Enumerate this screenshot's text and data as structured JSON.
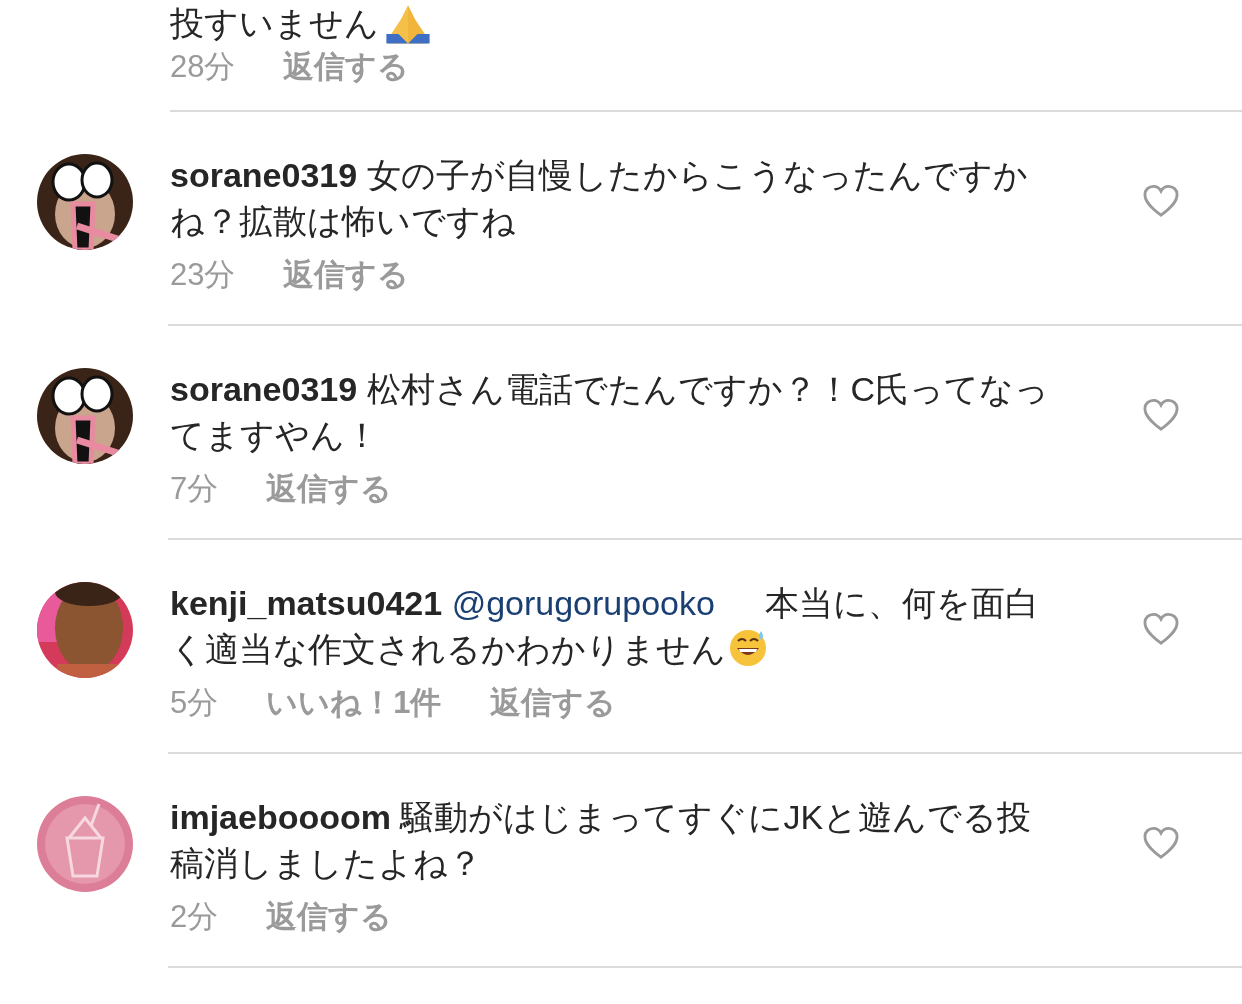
{
  "top_comment": {
    "kind": "pray",
    "text": "投すいません",
    "time": "28分",
    "reply": "返信する"
  },
  "comments": [
    {
      "kind": "plain",
      "user": "sorane0319",
      "text": "女の子が自慢したからこうなったんですかね？拡散は怖いですね",
      "time": "23分",
      "reply": "返信する",
      "liked": false
    },
    {
      "kind": "plain",
      "user": "sorane0319",
      "text": "松村さん電話でたんですか？！C氏ってなってますやん！",
      "time": "7分",
      "reply": "返信する",
      "liked": false
    },
    {
      "kind": "sweat_smile",
      "user": "kenji_matsu0421",
      "mention": "@gorugorupooko",
      "text": "本当に、何を面白く適当な作文されるかわかりません",
      "time": "5分",
      "likes": "いいね！1件",
      "reply": "返信する",
      "liked": false
    },
    {
      "kind": "plain",
      "user": "imjaeboooom",
      "text": "騒動がはじまってすぐにJKと遊んでる投稿消しましたよね？",
      "time": "2分",
      "reply": "返信する",
      "liked": false
    }
  ]
}
